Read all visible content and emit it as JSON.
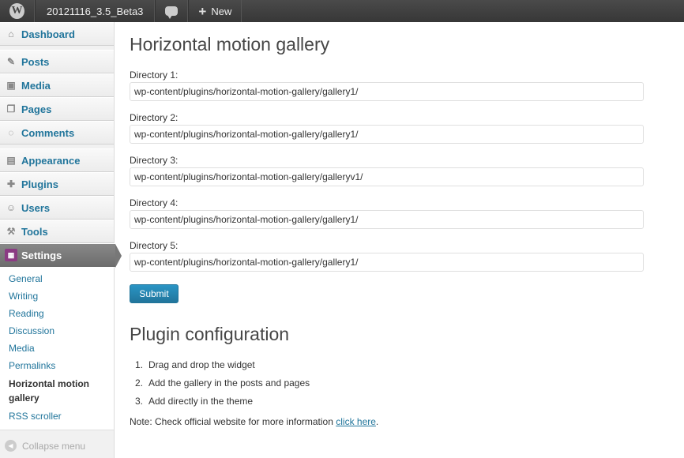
{
  "adminbar": {
    "site_name": "20121116_3.5_Beta3",
    "new_label": "New"
  },
  "sidebar": {
    "items": [
      {
        "label": "Dashboard",
        "icon": "home-icon",
        "glyph": "⌂"
      },
      {
        "label": "Posts",
        "icon": "pin-icon",
        "glyph": "✎"
      },
      {
        "label": "Media",
        "icon": "media-icon",
        "glyph": "▣"
      },
      {
        "label": "Pages",
        "icon": "pages-icon",
        "glyph": "❐"
      },
      {
        "label": "Comments",
        "icon": "comment-icon",
        "glyph": "◌"
      },
      {
        "label": "Appearance",
        "icon": "appearance-icon",
        "glyph": "▤"
      },
      {
        "label": "Plugins",
        "icon": "plug-icon",
        "glyph": "✚"
      },
      {
        "label": "Users",
        "icon": "users-icon",
        "glyph": "☺"
      },
      {
        "label": "Tools",
        "icon": "tools-icon",
        "glyph": "⚒"
      },
      {
        "label": "Settings",
        "icon": "settings-icon",
        "glyph": "▦"
      }
    ],
    "submenu": [
      "General",
      "Writing",
      "Reading",
      "Discussion",
      "Media",
      "Permalinks",
      "Horizontal motion gallery",
      "RSS scroller"
    ],
    "collapse_label": "Collapse menu"
  },
  "main": {
    "title": "Horizontal motion gallery",
    "fields": [
      {
        "label": "Directory 1:",
        "value": "wp-content/plugins/horizontal-motion-gallery/gallery1/"
      },
      {
        "label": "Directory 2:",
        "value": "wp-content/plugins/horizontal-motion-gallery/gallery1/"
      },
      {
        "label": "Directory 3:",
        "value": "wp-content/plugins/horizontal-motion-gallery/galleryv1/"
      },
      {
        "label": "Directory 4:",
        "value": "wp-content/plugins/horizontal-motion-gallery/gallery1/"
      },
      {
        "label": "Directory 5:",
        "value": "wp-content/plugins/horizontal-motion-gallery/gallery1/"
      }
    ],
    "submit_label": "Submit",
    "config_title": "Plugin configuration",
    "steps": [
      {
        "num": "1.",
        "text": "Drag and drop the widget"
      },
      {
        "num": "2.",
        "text": "Add the gallery in the posts and pages"
      },
      {
        "num": "3.",
        "text": "Add directly in the theme"
      }
    ],
    "note_text": "Note: Check official website for more information ",
    "note_link": "click here",
    "note_end": "."
  },
  "colors": {
    "link": "#21759b",
    "adminbar": "#464646",
    "settings_icon": "#8b3b83"
  }
}
